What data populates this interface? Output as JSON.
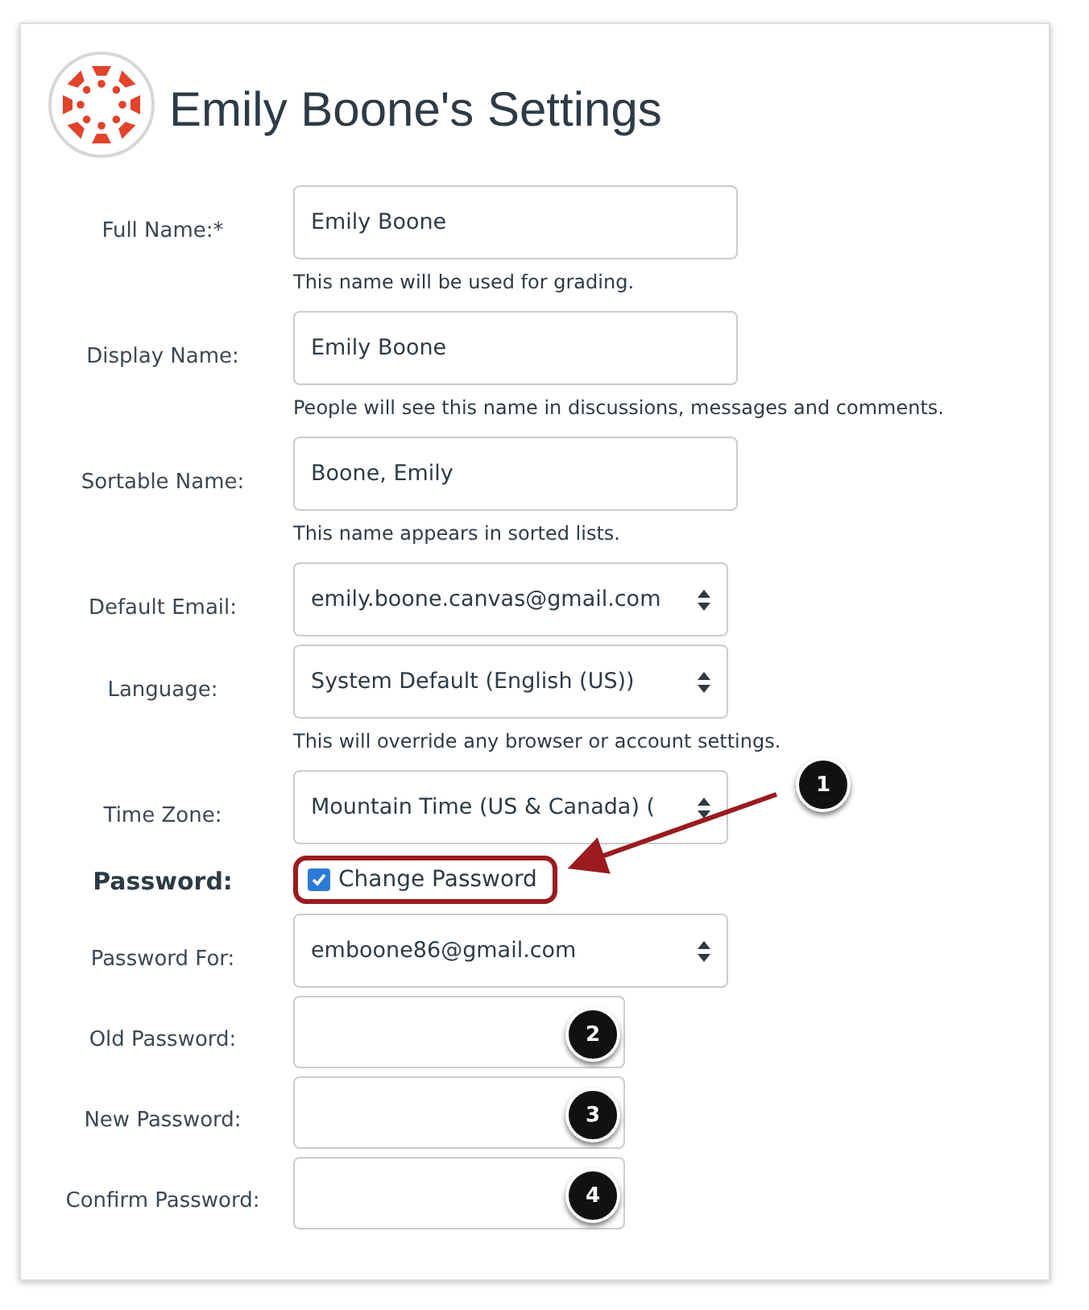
{
  "title": "Emily Boone's Settings",
  "fields": [
    {
      "kind": "text",
      "label": "Full Name:*",
      "value": "Emily Boone",
      "hint": "This name will be used for grading."
    },
    {
      "kind": "text",
      "label": "Display Name:",
      "value": "Emily Boone",
      "hint": "People will see this name in discussions, messages and comments."
    },
    {
      "kind": "text",
      "label": "Sortable Name:",
      "value": "Boone, Emily",
      "hint": "This name appears in sorted lists."
    },
    {
      "kind": "select",
      "label": "Default Email:",
      "value": "emily.boone.canvas@gmail.com"
    },
    {
      "kind": "select",
      "label": "Language:",
      "value": "System Default (English (US))",
      "hint": "This will override any browser or account settings."
    },
    {
      "kind": "select",
      "label": "Time Zone:",
      "value": "Mountain Time (US & Canada) ("
    },
    {
      "kind": "checkbox",
      "label": "Password:",
      "option": "Change Password",
      "checked": true,
      "callout": "1"
    },
    {
      "kind": "select",
      "label": "Password For:",
      "value": "emboone86@gmail.com"
    },
    {
      "kind": "password",
      "label": "Old Password:",
      "callout": "2"
    },
    {
      "kind": "password",
      "label": "New Password:",
      "callout": "3"
    },
    {
      "kind": "password",
      "label": "Confirm Password:",
      "callout": "4"
    }
  ]
}
